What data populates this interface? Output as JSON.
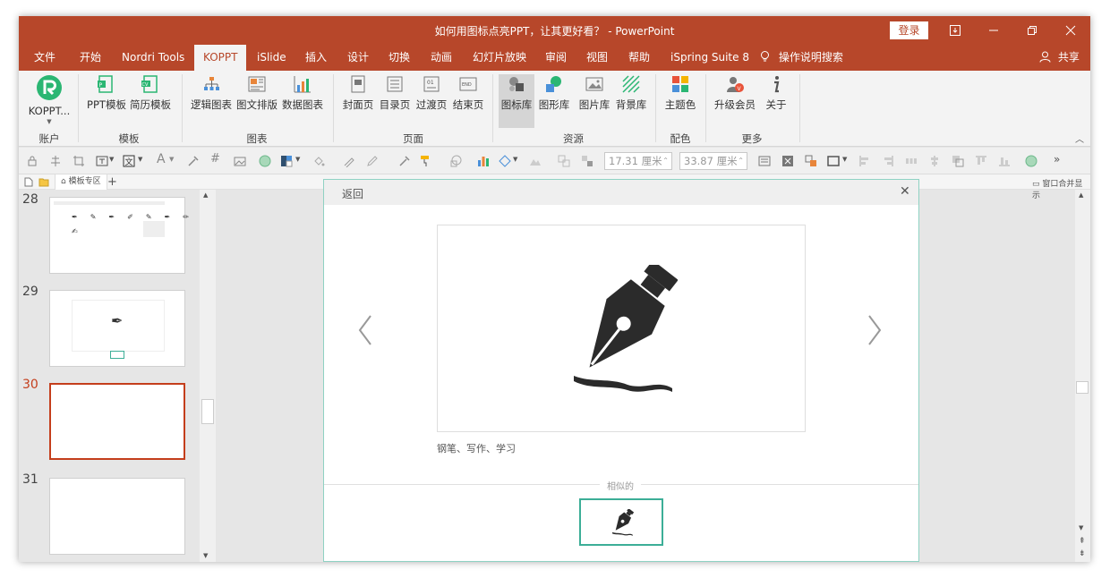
{
  "window": {
    "title": "如何用图标点亮PPT，让其更好看？ - PowerPoint",
    "login_label": "登录",
    "controls": [
      "ribbon-display-icon",
      "minimize-icon",
      "restore-icon",
      "close-icon"
    ]
  },
  "tabs": [
    {
      "label": "文件"
    },
    {
      "label": "开始"
    },
    {
      "label": "Nordri Tools"
    },
    {
      "label": "KOPPT",
      "active": true
    },
    {
      "label": "iSlide"
    },
    {
      "label": "插入"
    },
    {
      "label": "设计"
    },
    {
      "label": "切换"
    },
    {
      "label": "动画"
    },
    {
      "label": "幻灯片放映"
    },
    {
      "label": "审阅"
    },
    {
      "label": "视图"
    },
    {
      "label": "帮助"
    },
    {
      "label": "iSpring Suite 8"
    },
    {
      "label": "操作说明搜索"
    }
  ],
  "share_label": "共享",
  "ribbon": {
    "groups": [
      {
        "label": "账户",
        "buttons": [
          {
            "label": "KOPPT..."
          }
        ]
      },
      {
        "label": "模板",
        "buttons": [
          {
            "label": "PPT模板"
          },
          {
            "label": "简历模板"
          }
        ]
      },
      {
        "label": "图表",
        "buttons": [
          {
            "label": "逻辑图表"
          },
          {
            "label": "图文排版"
          },
          {
            "label": "数据图表"
          }
        ]
      },
      {
        "label": "页面",
        "buttons": [
          {
            "label": "封面页"
          },
          {
            "label": "目录页"
          },
          {
            "label": "过渡页"
          },
          {
            "label": "结束页"
          }
        ]
      },
      {
        "label": "资源",
        "buttons": [
          {
            "label": "图标库",
            "pressed": true
          },
          {
            "label": "图形库"
          },
          {
            "label": "图片库"
          },
          {
            "label": "背景库"
          }
        ]
      },
      {
        "label": "配色",
        "buttons": [
          {
            "label": "主题色"
          }
        ]
      },
      {
        "label": "更多",
        "buttons": [
          {
            "label": "升级会员"
          },
          {
            "label": "关于"
          }
        ]
      }
    ]
  },
  "toolbar": {
    "width_value": "17.31 厘米",
    "height_value": "33.87 厘米"
  },
  "subbar": {
    "tab_label": "模板专区",
    "right_label": "窗口合并显示"
  },
  "slides": [
    {
      "number": "28"
    },
    {
      "number": "29"
    },
    {
      "number": "30",
      "current": true
    },
    {
      "number": "31"
    }
  ],
  "dialog": {
    "back_label": "返回",
    "close_icon": "close-icon",
    "icon_name": "fountain-pen-icon",
    "tags": "钢笔、写作、学习",
    "similar_label": "相似的"
  },
  "colors": {
    "brand": "#b7472a",
    "accent_teal": "#3cae97",
    "current_slide": "#c43e1c"
  }
}
